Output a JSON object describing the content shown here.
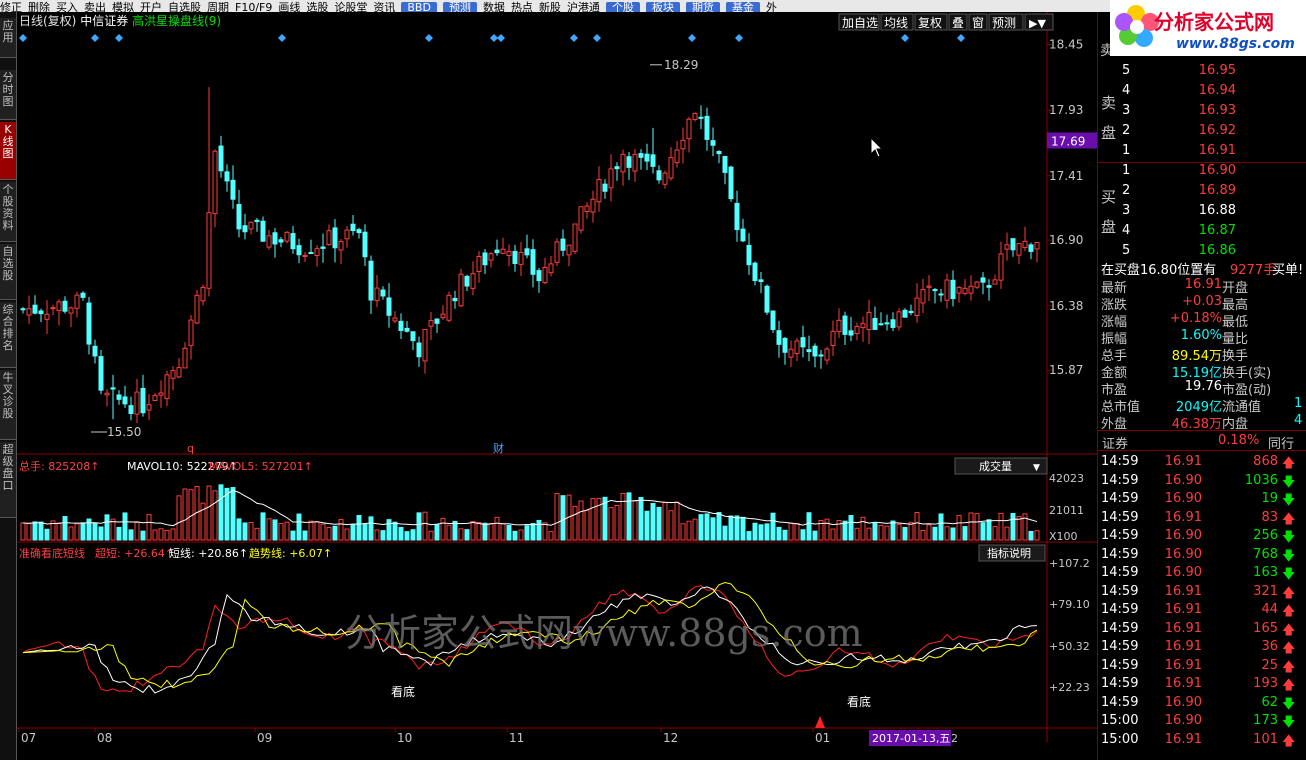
{
  "menubar": {
    "items": [
      "修正",
      "删除",
      "买入",
      "卖出",
      "模拟",
      "开户",
      "自选股",
      "周期",
      "F10/F9",
      "画线",
      "选股",
      "论股堂",
      "资讯",
      "BBD",
      "预测",
      "数据",
      "热点",
      "新股",
      "沪港通",
      "个股",
      "板块",
      "期货",
      "基金",
      "外"
    ]
  },
  "sidebar": {
    "items": [
      {
        "label": "应用",
        "active": false
      },
      {
        "label": "分时图",
        "active": false
      },
      {
        "label": "K线图",
        "active": true
      },
      {
        "label": "个股资料",
        "active": false
      },
      {
        "label": "自选股",
        "active": false
      },
      {
        "label": "综合排名",
        "active": false
      },
      {
        "label": "牛叉诊股",
        "active": false
      },
      {
        "label": "超级盘口",
        "active": false
      }
    ]
  },
  "header": {
    "period": "日线(复权)",
    "stock": "中信证券",
    "indicator_name": "高洪星操盘线(9)"
  },
  "toolbar": {
    "buttons": [
      "加自选",
      "均线",
      "复权",
      "叠",
      "窗",
      "预测"
    ]
  },
  "logo": {
    "title": "分析家公式网",
    "url": "www.88gs.com"
  },
  "main_chart": {
    "price_axis": [
      "18.45",
      "17.93",
      "17.41",
      "16.90",
      "16.38",
      "15.87"
    ],
    "current_price_tag": "17.69",
    "high_label": "18.29",
    "low_label": "15.50",
    "marker_q": "q",
    "marker_cai": "财"
  },
  "volume_panel": {
    "label_total": "总手: 825208↑",
    "label_mavol10": "MAVOL10: 522279↑",
    "label_mavol5": "MAVOL5: 527201↑",
    "axis": [
      "42023",
      "21011",
      "X100"
    ],
    "dropdown": "成交量"
  },
  "indicator_panel": {
    "title": "准确看底短线",
    "label_super": "超短: +26.64↑",
    "label_short": "短线: +20.86↑",
    "label_trend": "趋势线: +6.07↑",
    "axis": [
      "+107.2",
      "+79.10",
      "+50.32",
      "+22.23"
    ],
    "button": "指标说明",
    "annotations": [
      "看底",
      "看底"
    ]
  },
  "x_axis": {
    "labels": [
      "07",
      "08",
      "09",
      "10",
      "11",
      "12",
      "01"
    ],
    "cursor_date": "2017-01-13,五",
    "cursor_suffix": "2"
  },
  "watermark": "分析家公式网www.88gs.com",
  "quote": {
    "sell_header": "卖",
    "sell_label": "卖盘",
    "buy_label": "买盘",
    "sell": [
      {
        "n": "5",
        "p": "16.95"
      },
      {
        "n": "4",
        "p": "16.94"
      },
      {
        "n": "3",
        "p": "16.93"
      },
      {
        "n": "2",
        "p": "16.92"
      },
      {
        "n": "1",
        "p": "16.91"
      }
    ],
    "buy": [
      {
        "n": "1",
        "p": "16.90"
      },
      {
        "n": "2",
        "p": "16.89"
      },
      {
        "n": "3",
        "p": "16.88"
      },
      {
        "n": "4",
        "p": "16.87"
      },
      {
        "n": "5",
        "p": "16.86"
      }
    ],
    "position_line": {
      "left": "在买盘16.80位置有",
      "qty": "9277手",
      "right": "买单! 查"
    },
    "stats": [
      {
        "k": "最新",
        "v": "16.91",
        "k2": "开盘",
        "c": "red"
      },
      {
        "k": "涨跌",
        "v": "+0.03",
        "k2": "最高",
        "c": "red"
      },
      {
        "k": "涨幅",
        "v": "+0.18%",
        "k2": "最低",
        "c": "red"
      },
      {
        "k": "振幅",
        "v": "1.60%",
        "k2": "量比",
        "c": "cyan"
      },
      {
        "k": "总手",
        "v": "89.54",
        "u": "万",
        "k2": "换手",
        "c": "yellow"
      },
      {
        "k": "金额",
        "v": "15.19",
        "u": "亿",
        "k2": "换手(实)",
        "c": "cyan"
      },
      {
        "k": "市盈",
        "v": "19.76",
        "k2": "市盈(动)",
        "c": "white"
      },
      {
        "k": "总市值",
        "v": "2049",
        "u": "亿",
        "k2": "流通值",
        "extra": "1",
        "c": "cyan"
      },
      {
        "k": "外盘",
        "v": "46.38",
        "u": "万",
        "k2": "内盘",
        "extra": "4",
        "c": "red"
      }
    ],
    "sector": {
      "name": "证券",
      "change": "0.18%",
      "peer": "同行"
    },
    "ticks": [
      {
        "t": "14:59",
        "p": "16.91",
        "v": "868",
        "d": "up"
      },
      {
        "t": "14:59",
        "p": "16.90",
        "v": "1036",
        "d": "down"
      },
      {
        "t": "14:59",
        "p": "16.90",
        "v": "19",
        "d": "down"
      },
      {
        "t": "14:59",
        "p": "16.91",
        "v": "83",
        "d": "up"
      },
      {
        "t": "14:59",
        "p": "16.90",
        "v": "256",
        "d": "down"
      },
      {
        "t": "14:59",
        "p": "16.90",
        "v": "768",
        "d": "down"
      },
      {
        "t": "14:59",
        "p": "16.90",
        "v": "163",
        "d": "down"
      },
      {
        "t": "14:59",
        "p": "16.91",
        "v": "321",
        "d": "up"
      },
      {
        "t": "14:59",
        "p": "16.91",
        "v": "44",
        "d": "up"
      },
      {
        "t": "14:59",
        "p": "16.91",
        "v": "165",
        "d": "up"
      },
      {
        "t": "14:59",
        "p": "16.91",
        "v": "36",
        "d": "up"
      },
      {
        "t": "14:59",
        "p": "16.91",
        "v": "25",
        "d": "up"
      },
      {
        "t": "14:59",
        "p": "16.91",
        "v": "193",
        "d": "up"
      },
      {
        "t": "14:59",
        "p": "16.90",
        "v": "62",
        "d": "down"
      },
      {
        "t": "15:00",
        "p": "16.90",
        "v": "173",
        "d": "down"
      },
      {
        "t": "15:00",
        "p": "16.91",
        "v": "101",
        "d": "up"
      }
    ]
  },
  "colors": {
    "up": "#ff3c3c",
    "down": "#54ffff",
    "bg": "#000000",
    "axis": "#8b0000"
  }
}
